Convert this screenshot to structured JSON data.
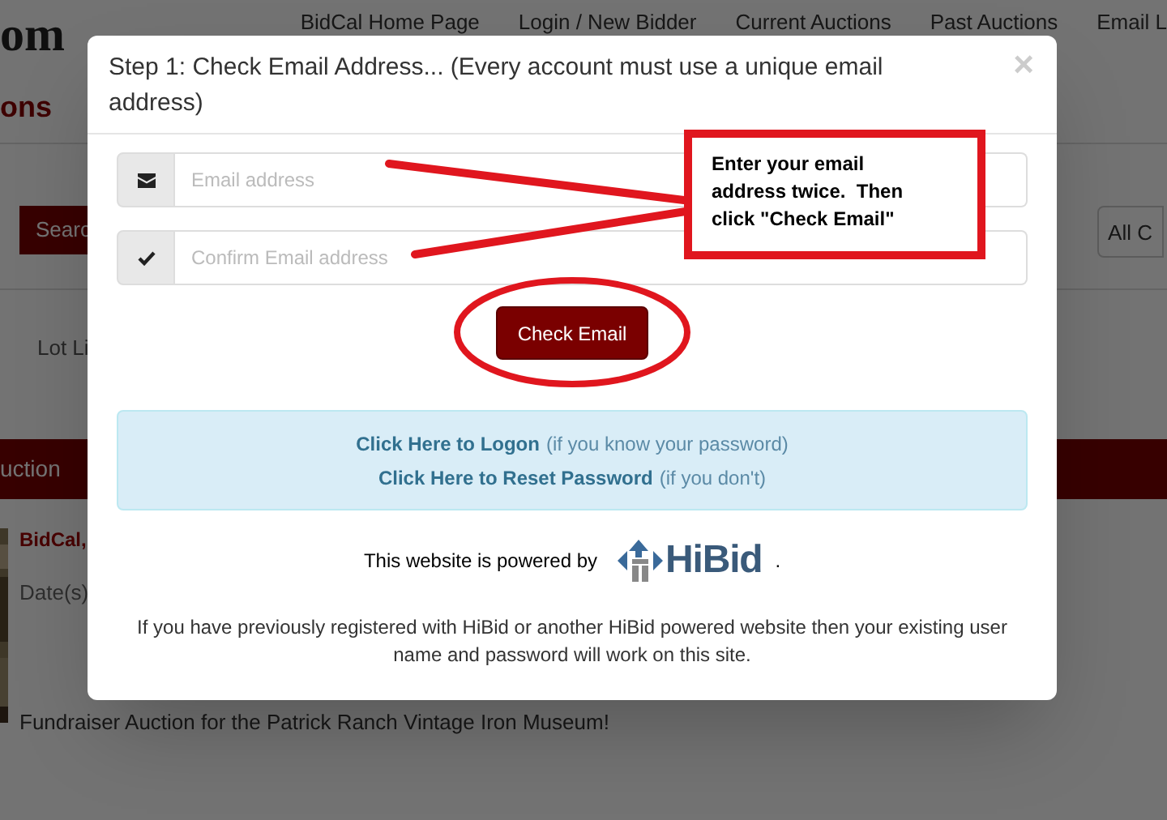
{
  "background_page": {
    "logo_top": "om",
    "logo_bottom": "ons",
    "nav": [
      "BidCal Home Page",
      "Login / New Bidder",
      "Current Auctions",
      "Past Auctions",
      "Email L"
    ],
    "search_button": "Searc",
    "category_dropdown": "All C",
    "tab": "Lot Li",
    "section_bar": "uction",
    "auction_title": "BidCal,",
    "dates_label": "Date(s)",
    "description": "Fundraiser Auction for the Patrick Ranch Vintage Iron Museum!"
  },
  "dialog": {
    "title": "Step 1: Check Email Address... (Every account must use a unique email address)",
    "close": "×",
    "fields": [
      {
        "placeholder": "Email address"
      },
      {
        "placeholder": "Confirm Email address"
      }
    ],
    "button": "Check Email",
    "info_lines": [
      {
        "link": "Click Here to Logon",
        "note": "(if you know your password)"
      },
      {
        "link": "Click Here to Reset Password",
        "note": "(if you don't)"
      }
    ],
    "powered_by": "This website is powered by",
    "brand": "HiBid",
    "brand_suffix": ".",
    "note": "If you have previously registered with HiBid or another HiBid powered website then your existing user name and password will work on this site."
  },
  "annotation": {
    "callout": "Enter your email address twice.  Then click \"Check Email\""
  }
}
